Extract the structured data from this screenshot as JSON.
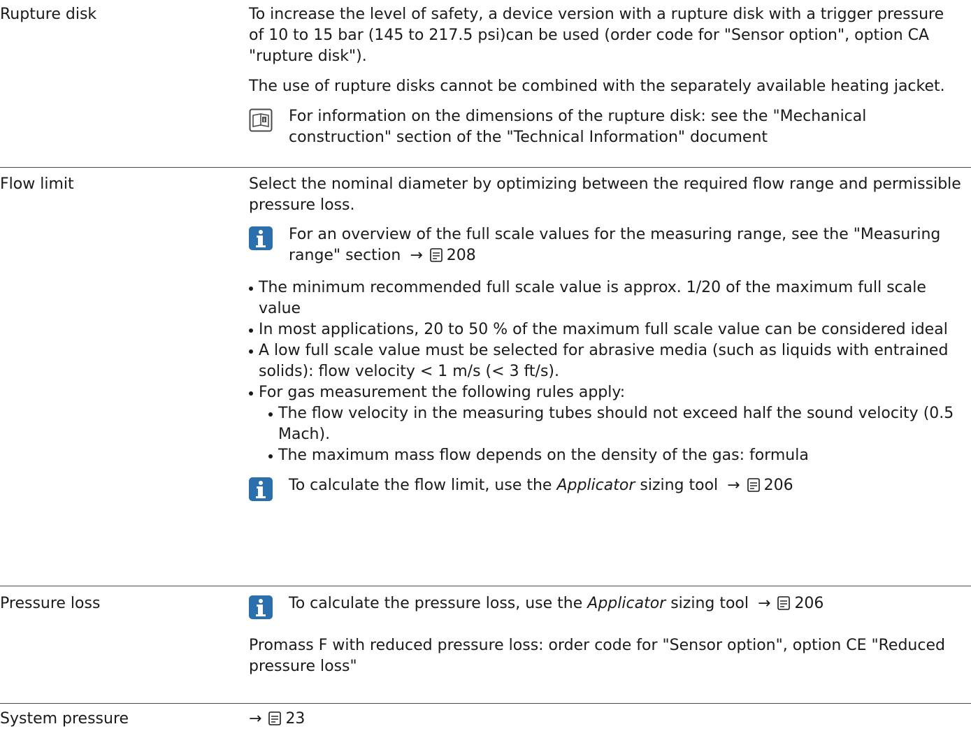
{
  "rupture": {
    "label": "Rupture disk",
    "p1": "To increase the level of safety, a device version with a rupture disk with a trigger pressure of 10 to 15 bar (145 to 217.5 psi)can be used (order code for \"Sensor option\", option CA \"rupture disk\").",
    "p2": "The use of rupture disks cannot be combined with the separately available heating jacket.",
    "note": "For information on the dimensions of the rupture disk: see the \"Mechanical construction\" section of the \"Technical Information\" document"
  },
  "flow": {
    "label": "Flow limit",
    "p1": "Select the nominal diameter by optimizing between the required flow range and permissible pressure loss.",
    "note1_text": "For an overview of the full scale values for the measuring range, see the \"Measuring range\" section",
    "note1_page": "208",
    "bullets": [
      "The minimum recommended full scale value is approx. 1/20 of the maximum full scale value",
      "In most applications, 20 to 50 % of the maximum full scale value can be considered ideal",
      "A low full scale value must be selected for abrasive media (such as liquids with entrained solids): flow velocity < 1 m/s (< 3 ft/s).",
      "For gas measurement the following rules apply:"
    ],
    "subbullets": [
      "The flow velocity in the measuring tubes should not exceed half the sound velocity (0.5 Mach).",
      "The maximum mass flow depends on the density of the gas: formula"
    ],
    "note2_pre": "To calculate the flow limit, use the",
    "note2_ital": "Applicator",
    "note2_post": "sizing tool",
    "note2_page": "206"
  },
  "pressure": {
    "label": "Pressure loss",
    "note_pre": "To calculate the pressure loss, use the",
    "note_ital": "Applicator",
    "note_post": "sizing tool",
    "note_page": "206",
    "p1": "Promass F with reduced pressure loss: order code for \"Sensor option\", option CE \"Reduced pressure loss\""
  },
  "system": {
    "label": "System pressure",
    "page": "23"
  },
  "arrow": "→",
  "icons": {
    "info": "info-icon",
    "book": "book-reference-icon",
    "manual": "document-reference-icon"
  },
  "colors": {
    "info_blue": "#2b6fad",
    "rule": "#4a4a4a"
  }
}
